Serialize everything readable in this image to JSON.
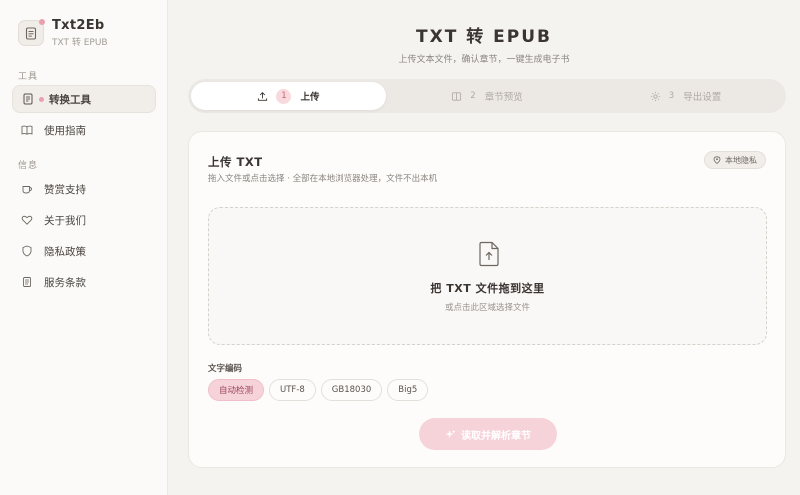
{
  "brand": {
    "name": "Txt2Eb",
    "subtitle": "TXT 转 EPUB"
  },
  "sidebar": {
    "sections": [
      {
        "label": "工具",
        "items": [
          {
            "label": "转换工具",
            "icon": "document-icon",
            "active": true
          },
          {
            "label": "使用指南",
            "icon": "book-icon",
            "active": false
          }
        ]
      },
      {
        "label": "信息",
        "items": [
          {
            "label": "赞赏支持",
            "icon": "coffee-icon"
          },
          {
            "label": "关于我们",
            "icon": "heart-icon"
          },
          {
            "label": "隐私政策",
            "icon": "shield-icon"
          },
          {
            "label": "服务条款",
            "icon": "scroll-icon"
          }
        ]
      }
    ]
  },
  "header": {
    "title": "TXT 转 EPUB",
    "subtitle": "上传文本文件，确认章节，一键生成电子书"
  },
  "steps": [
    {
      "num": "1",
      "label": "上传",
      "icon": "upload-icon",
      "active": true
    },
    {
      "num": "2",
      "label": "章节预览",
      "icon": "book-icon",
      "active": false
    },
    {
      "num": "3",
      "label": "导出设置",
      "icon": "gear-icon",
      "active": false
    }
  ],
  "card": {
    "title": "上传 TXT",
    "description": "拖入文件或点击选择 · 全部在本地浏览器处理，文件不出本机",
    "badge": "本地隐私",
    "dropzone": {
      "title": "把 TXT 文件拖到这里",
      "subtitle": "或点击此区域选择文件"
    },
    "encoding": {
      "label": "文字编码",
      "options": [
        "自动检测",
        "UTF-8",
        "GB18030",
        "Big5"
      ],
      "selected": "自动检测"
    },
    "action_label": "读取并解析章节"
  },
  "colors": {
    "accent": "#e8a1ad",
    "accent_soft": "#f6d3d9",
    "background": "#f5f3f0"
  }
}
